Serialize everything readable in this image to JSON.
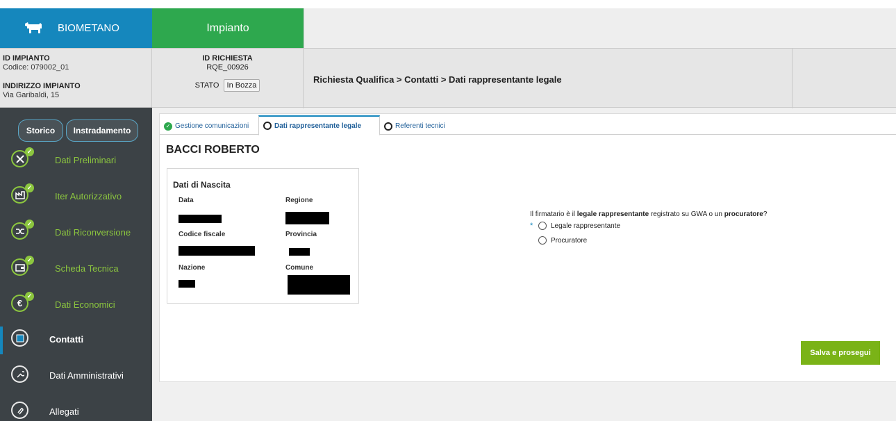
{
  "header": {
    "brand_label": "BIOMETANO",
    "brand_icon": "cow-icon",
    "section_tab": "Impianto"
  },
  "info": {
    "impianto_id_label": "ID IMPIANTO",
    "impianto_code": "Codice: 079002_01",
    "address_label": "INDIRIZZO IMPIANTO",
    "address_value": "Via Garibaldi, 15",
    "richiesta_label": "ID RICHIESTA",
    "richiesta_value": "RQE_00926",
    "stato_label": "STATO",
    "stato_value": "In Bozza",
    "breadcrumb": "Richiesta Qualifica > Contatti > Dati rappresentante legale"
  },
  "sidebar": {
    "storico": "Storico",
    "instradamento": "Instradamento",
    "items": [
      {
        "label": "Dati Preliminari",
        "icon": "tools-icon",
        "completed": true
      },
      {
        "label": "Iter Autorizzativo",
        "icon": "factory-icon",
        "completed": true
      },
      {
        "label": "Dati Riconversione",
        "icon": "shuffle-icon",
        "completed": true
      },
      {
        "label": "Scheda Tecnica",
        "icon": "wallet-icon",
        "completed": true
      },
      {
        "label": "Dati Economici",
        "icon": "euro-icon",
        "completed": true
      },
      {
        "label": "Contatti",
        "icon": "contacts-icon",
        "completed": false,
        "active": true
      },
      {
        "label": "Dati Amministrativi",
        "icon": "wrench-icon",
        "completed": false
      },
      {
        "label": "Allegati",
        "icon": "paperclip-icon",
        "completed": false
      }
    ]
  },
  "tabs": [
    {
      "label": "Gestione comunicazioni",
      "state": "completed"
    },
    {
      "label": "Dati rappresentante legale",
      "state": "active"
    },
    {
      "label": "Referenti tecnici",
      "state": "pending"
    }
  ],
  "person": {
    "name": "BACCI ROBERTO"
  },
  "birth": {
    "title": "Dati di Nascita",
    "data_label": "Data",
    "regione_label": "Regione",
    "codice_fiscale_label": "Codice fiscale",
    "provincia_label": "Provincia",
    "nazione_label": "Nazione",
    "comune_label": "Comune"
  },
  "question": {
    "text_1": "Il firmatario è il ",
    "bold_1": "legale rappresentante",
    "text_2": " registrato su GWA o un ",
    "bold_2": "procuratore",
    "text_3": "?",
    "required_mark": "*",
    "options": [
      "Legale rappresentante",
      "Procuratore"
    ]
  },
  "actions": {
    "save": "Salva e prosegui"
  },
  "colors": {
    "brand_blue": "#1587bd",
    "tab_green": "#2ea84e",
    "sidebar_bg": "#3c4246",
    "nav_green": "#8cc63f",
    "save_green": "#7ab317"
  }
}
